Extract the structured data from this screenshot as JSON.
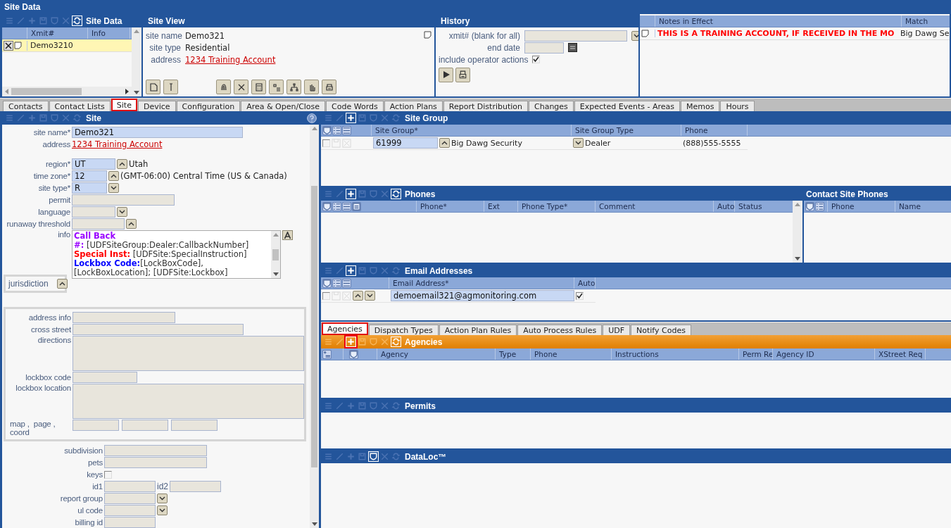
{
  "window": {
    "title": "Site Data"
  },
  "site_data": {
    "title": "Site Data",
    "toolbar": [
      {
        "kind": "list",
        "enabled": false
      },
      {
        "kind": "edit",
        "enabled": false
      },
      {
        "kind": "add",
        "enabled": false
      },
      {
        "kind": "save",
        "enabled": false
      },
      {
        "kind": "delete",
        "enabled": false
      },
      {
        "kind": "close",
        "enabled": false
      },
      {
        "kind": "refresh",
        "enabled": true
      }
    ],
    "columns": [
      "Xmit#",
      "Info"
    ],
    "rows": [
      {
        "xmit": "Demo3210",
        "selected": true
      }
    ]
  },
  "site_view": {
    "title": "Site View",
    "fields": [
      {
        "label": "site name",
        "value": "Demo321",
        "kind": "text"
      },
      {
        "label": "site type",
        "value": "Residential",
        "kind": "text"
      },
      {
        "label": "address",
        "value": "1234 Training Account",
        "kind": "link"
      }
    ]
  },
  "history": {
    "title": "History",
    "xmit_label": "xmit#  (blank for all)",
    "end_date_label": "end date",
    "include_label": "include operator actions",
    "include_checked": true
  },
  "notes": {
    "columns": [
      "Notes in Effect",
      "Match"
    ],
    "rows": [
      {
        "note": "THIS IS A TRAINING ACCOUNT, IF RECEIVED IN THE MO",
        "match": "Big Dawg Se"
      }
    ]
  },
  "tabs": [
    {
      "label": "Contacts",
      "selected": false,
      "highlighted": false
    },
    {
      "label": "Contact Lists",
      "selected": false,
      "highlighted": false
    },
    {
      "label": "Site",
      "selected": true,
      "highlighted": true
    },
    {
      "label": "Device",
      "selected": false,
      "highlighted": false
    },
    {
      "label": "Configuration",
      "selected": false,
      "highlighted": false
    },
    {
      "label": "Area & Open/Close",
      "selected": false,
      "highlighted": false
    },
    {
      "label": "Code Words",
      "selected": false,
      "highlighted": false
    },
    {
      "label": "Action Plans",
      "selected": false,
      "highlighted": false
    },
    {
      "label": "Report Distribution",
      "selected": false,
      "highlighted": false
    },
    {
      "label": "Changes",
      "selected": false,
      "highlighted": false
    },
    {
      "label": "Expected Events - Areas",
      "selected": false,
      "highlighted": false
    },
    {
      "label": "Memos",
      "selected": false,
      "highlighted": false
    },
    {
      "label": "Hours",
      "selected": false,
      "highlighted": false
    }
  ],
  "site": {
    "title": "Site",
    "toolbar": [
      {
        "kind": "list",
        "enabled": false
      },
      {
        "kind": "edit",
        "enabled": false
      },
      {
        "kind": "add",
        "enabled": false
      },
      {
        "kind": "save",
        "enabled": false
      },
      {
        "kind": "delete",
        "enabled": false
      },
      {
        "kind": "close",
        "enabled": false
      },
      {
        "kind": "refresh",
        "enabled": false
      }
    ],
    "site_name": {
      "label": "site name*",
      "value": "Demo321"
    },
    "address": {
      "label": "address",
      "value": "1234 Training Account"
    },
    "region": {
      "label": "region*",
      "value": "UT",
      "description": "Utah"
    },
    "time_zone": {
      "label": "time zone*",
      "value": "12",
      "description": "(GMT-06:00) Central Time (US & Canada)"
    },
    "site_type": {
      "label": "site type*",
      "value": "R"
    },
    "permit": {
      "label": "permit"
    },
    "language": {
      "label": "language"
    },
    "runaway_threshold": {
      "label": "runaway threshold"
    },
    "info": {
      "label": "info",
      "lines": [
        {
          "label": "Call Back",
          "color": "#9900ff"
        },
        {
          "label": "#:",
          "text": " [UDFSiteGroup:Dealer:CallbackNumber]",
          "color": "#9900ff"
        },
        {
          "label": "Special Inst:",
          "text": " [UDFSite:SpecialInstruction]",
          "color": "#ff0000"
        },
        {
          "label": "Lockbox Code:",
          "text": "[LockBoxCode],",
          "color": "#0000ff"
        },
        {
          "text": "[LockBoxLocation]; [UDFSite:Lockbox]"
        }
      ]
    },
    "jurisdiction": {
      "label": "jurisdiction"
    },
    "address_info": {
      "label": "address info"
    },
    "cross_street": {
      "label": "cross street"
    },
    "directions": {
      "label": "directions"
    },
    "lockbox_code": {
      "label": "lockbox code"
    },
    "lockbox_location": {
      "label": "lockbox location"
    },
    "map_page_coord": {
      "label": "map ,  page ,\ncoord"
    },
    "subdivision": {
      "label": "subdivision"
    },
    "pets": {
      "label": "pets"
    },
    "keys": {
      "label": "keys",
      "checked": false
    },
    "id1": {
      "label": "id1"
    },
    "id2": {
      "label": "id2"
    },
    "report_group": {
      "label": "report group"
    },
    "ul_code": {
      "label": "ul code"
    },
    "billing_id": {
      "label": "billing id"
    }
  },
  "site_group": {
    "title": "Site Group",
    "toolbar": [
      {
        "kind": "list",
        "enabled": false
      },
      {
        "kind": "edit",
        "enabled": false
      },
      {
        "kind": "add",
        "enabled": true
      },
      {
        "kind": "save",
        "enabled": false
      },
      {
        "kind": "delete",
        "enabled": false
      },
      {
        "kind": "close",
        "enabled": false
      },
      {
        "kind": "refresh",
        "enabled": false
      }
    ],
    "columns": [
      "Site Group*",
      "Site Group Type",
      "Phone"
    ],
    "rows": [
      {
        "checked": false,
        "site_group": "61999",
        "name": "Big Dawg Security",
        "type": "Dealer",
        "phone": "(888)555-5555"
      }
    ]
  },
  "phones": {
    "title": "Phones",
    "toolbar": [
      {
        "kind": "list",
        "enabled": false
      },
      {
        "kind": "edit",
        "enabled": false
      },
      {
        "kind": "add",
        "enabled": true
      },
      {
        "kind": "save",
        "enabled": false
      },
      {
        "kind": "delete",
        "enabled": false
      },
      {
        "kind": "close",
        "enabled": false
      },
      {
        "kind": "refresh",
        "enabled": true
      }
    ],
    "columns": [
      "Phone*",
      "Ext",
      "Phone Type*",
      "Comment",
      "Auto",
      "Status"
    ]
  },
  "contact_site_phones": {
    "title": "Contact Site Phones",
    "columns": [
      "Phone",
      "Name"
    ]
  },
  "email_addresses": {
    "title": "Email Addresses",
    "toolbar": [
      {
        "kind": "list",
        "enabled": false
      },
      {
        "kind": "edit",
        "enabled": false
      },
      {
        "kind": "add",
        "enabled": true
      },
      {
        "kind": "save",
        "enabled": false
      },
      {
        "kind": "delete",
        "enabled": false
      },
      {
        "kind": "close",
        "enabled": false
      },
      {
        "kind": "refresh",
        "enabled": false
      }
    ],
    "columns": [
      "Email Address*",
      "Auto"
    ],
    "rows": [
      {
        "checked": false,
        "email": "demoemail321@agmonitoring.com",
        "auto": true
      }
    ]
  },
  "sub_tabs": [
    {
      "label": "Agencies",
      "selected": true,
      "highlighted": true
    },
    {
      "label": "Dispatch Types",
      "selected": false,
      "highlighted": false
    },
    {
      "label": "Action Plan Rules",
      "selected": false,
      "highlighted": false
    },
    {
      "label": "Auto Process Rules",
      "selected": false,
      "highlighted": false
    },
    {
      "label": "UDF",
      "selected": false,
      "highlighted": false
    },
    {
      "label": "Notify Codes",
      "selected": false,
      "highlighted": false
    }
  ],
  "agencies": {
    "title": "Agencies",
    "toolbar": [
      {
        "kind": "list",
        "enabled": false,
        "highlighted": false
      },
      {
        "kind": "edit",
        "enabled": false,
        "highlighted": false
      },
      {
        "kind": "add",
        "enabled": true,
        "highlighted": true
      },
      {
        "kind": "save",
        "enabled": false,
        "highlighted": false
      },
      {
        "kind": "delete",
        "enabled": false,
        "highlighted": false
      },
      {
        "kind": "close",
        "enabled": false,
        "highlighted": false
      },
      {
        "kind": "refresh",
        "enabled": true,
        "highlighted": false
      }
    ],
    "columns": [
      "Agency",
      "Type",
      "Phone",
      "Instructions",
      "Perm Re",
      "Agency ID",
      "XStreet Req"
    ]
  },
  "permits": {
    "title": "Permits",
    "toolbar": [
      {
        "kind": "list",
        "enabled": false
      },
      {
        "kind": "edit",
        "enabled": false
      },
      {
        "kind": "add",
        "enabled": false
      },
      {
        "kind": "save",
        "enabled": false
      },
      {
        "kind": "delete",
        "enabled": false
      },
      {
        "kind": "close",
        "enabled": false
      },
      {
        "kind": "refresh",
        "enabled": false
      }
    ]
  },
  "dataloc": {
    "title": "DataLoc™",
    "toolbar": [
      {
        "kind": "list",
        "enabled": false
      },
      {
        "kind": "edit",
        "enabled": false
      },
      {
        "kind": "add",
        "enabled": false
      },
      {
        "kind": "save",
        "enabled": false
      },
      {
        "kind": "delete",
        "enabled": true
      },
      {
        "kind": "close",
        "enabled": false
      },
      {
        "kind": "refresh",
        "enabled": false
      }
    ]
  }
}
